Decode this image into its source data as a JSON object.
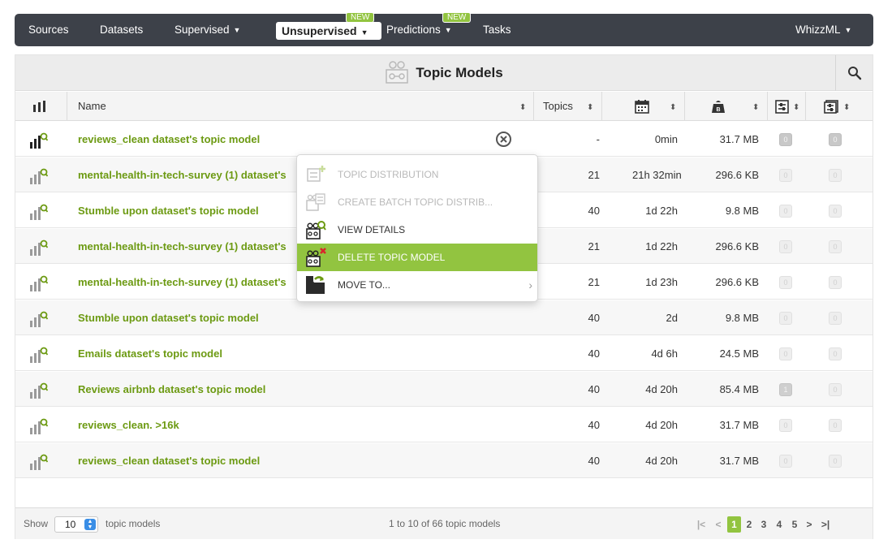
{
  "nav": {
    "sources": "Sources",
    "datasets": "Datasets",
    "supervised": "Supervised",
    "unsupervised": "Unsupervised",
    "predictions": "Predictions",
    "tasks": "Tasks",
    "whizzml": "WhizzML",
    "new_badge": "NEW"
  },
  "panel": {
    "title": "Topic Models"
  },
  "columns": {
    "name": "Name",
    "topics": "Topics"
  },
  "rows": [
    {
      "name": "reviews_clean dataset's topic model",
      "topics": "-",
      "time": "0min",
      "size": "31.7 MB",
      "b1": "0",
      "b2": "0"
    },
    {
      "name": "mental-health-in-tech-survey (1) dataset's",
      "topics": "21",
      "time": "21h 32min",
      "size": "296.6 KB",
      "b1": "0",
      "b2": "0"
    },
    {
      "name": "Stumble upon dataset's topic model",
      "topics": "40",
      "time": "1d 22h",
      "size": "9.8 MB",
      "b1": "0",
      "b2": "0"
    },
    {
      "name": "mental-health-in-tech-survey (1) dataset's",
      "topics": "21",
      "time": "1d 22h",
      "size": "296.6 KB",
      "b1": "0",
      "b2": "0"
    },
    {
      "name": "mental-health-in-tech-survey (1) dataset's",
      "topics": "21",
      "time": "1d 23h",
      "size": "296.6 KB",
      "b1": "0",
      "b2": "0"
    },
    {
      "name": "Stumble upon dataset's topic model",
      "topics": "40",
      "time": "2d",
      "size": "9.8 MB",
      "b1": "0",
      "b2": "0"
    },
    {
      "name": "Emails dataset's topic model",
      "topics": "40",
      "time": "4d 6h",
      "size": "24.5 MB",
      "b1": "0",
      "b2": "0"
    },
    {
      "name": "Reviews airbnb dataset's topic model",
      "topics": "40",
      "time": "4d 20h",
      "size": "85.4 MB",
      "b1": "1",
      "b2": "0"
    },
    {
      "name": "reviews_clean. >16k",
      "topics": "40",
      "time": "4d 20h",
      "size": "31.7 MB",
      "b1": "0",
      "b2": "0"
    },
    {
      "name": "reviews_clean dataset's topic model",
      "topics": "40",
      "time": "4d 20h",
      "size": "31.7 MB",
      "b1": "0",
      "b2": "0"
    }
  ],
  "context_menu": {
    "items": [
      {
        "label": "TOPIC DISTRIBUTION",
        "enabled": false
      },
      {
        "label": "CREATE BATCH TOPIC DISTRIB...",
        "enabled": false
      },
      {
        "label": "VIEW DETAILS",
        "enabled": true
      },
      {
        "label": "DELETE TOPIC MODEL",
        "enabled": true,
        "highlighted": true
      },
      {
        "label": "MOVE TO...",
        "enabled": true,
        "submenu": true
      }
    ]
  },
  "footer": {
    "show_label": "Show",
    "page_size": "10",
    "per_label": "topic models",
    "count_label": "1 to 10 of 66 topic models",
    "pages": [
      "1",
      "2",
      "3",
      "4",
      "5"
    ],
    "current_page": "1"
  },
  "colors": {
    "accent": "#92c440",
    "link": "#6c9a12",
    "navbar": "#3d4149"
  }
}
